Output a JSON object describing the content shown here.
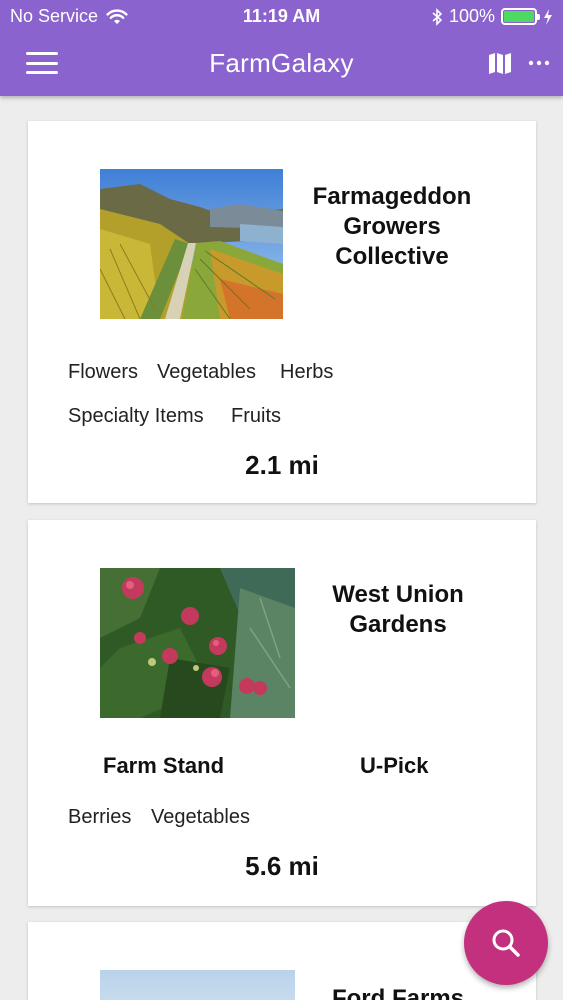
{
  "status_bar": {
    "carrier": "No Service",
    "time": "11:19 AM",
    "battery_percent": "100%",
    "battery_level": 1.0,
    "icons": [
      "wifi-icon",
      "bluetooth-icon",
      "battery-icon",
      "charging-icon"
    ]
  },
  "app_bar": {
    "title": "FarmGalaxy",
    "icons": [
      "menu-icon",
      "map-icon",
      "more-icon"
    ]
  },
  "colors": {
    "header": "#8a63cf",
    "fab": "#c2307e",
    "background": "#ededed",
    "battery": "#4cd964"
  },
  "farms": [
    {
      "name": "Farmageddon Growers Collective",
      "name_lines": [
        "Farmageddon",
        "Growers",
        "Collective"
      ],
      "tags": [
        "Flowers",
        "Vegetables",
        "Herbs",
        "Specialty Items",
        "Fruits"
      ],
      "distance": "2.1 mi"
    },
    {
      "name": "West Union Gardens",
      "name_lines": [
        "West Union",
        "Gardens"
      ],
      "features": [
        "Farm Stand",
        "U-Pick"
      ],
      "tags": [
        "Berries",
        "Vegetables"
      ],
      "distance": "5.6 mi"
    },
    {
      "name": "Ford Farms",
      "name_lines": [
        "Ford Farms"
      ]
    }
  ],
  "fab": {
    "icon": "search-icon"
  }
}
